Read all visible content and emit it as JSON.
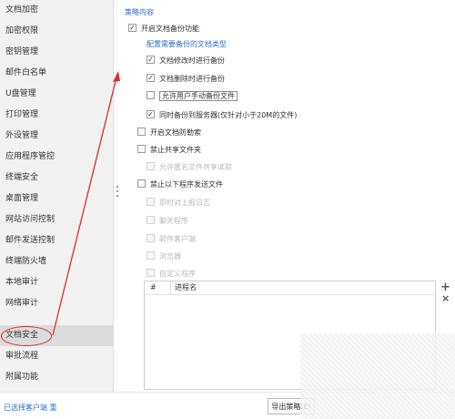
{
  "sidebar": {
    "items": [
      {
        "label": "文档加密"
      },
      {
        "label": "加密权限"
      },
      {
        "label": "密钥管理"
      },
      {
        "label": "邮件白名单"
      },
      {
        "label": "U盘管理"
      },
      {
        "label": "打印管理"
      },
      {
        "label": "外设管理"
      },
      {
        "label": "应用程序管控"
      },
      {
        "label": "终端安全"
      },
      {
        "label": "桌面管理"
      },
      {
        "label": "网站访问控制"
      },
      {
        "label": "邮件发送控制"
      },
      {
        "label": "终端防火墙"
      },
      {
        "label": "本地审计"
      },
      {
        "label": "网络审计"
      },
      {
        "label": "文档安全"
      },
      {
        "label": "审批流程"
      },
      {
        "label": "附属功能"
      }
    ],
    "active_index": 15,
    "bottom_link": "已选择客户端 重"
  },
  "main": {
    "section_title": "策略内容",
    "options": {
      "enable_backup": {
        "label": "开启文档备份功能",
        "checked": true
      },
      "group_title": "配置需要备份的文档类型",
      "modify_backup": {
        "label": "文档修改时进行备份",
        "checked": true
      },
      "delete_backup": {
        "label": "文档删除时进行备份",
        "checked": true
      },
      "manual_backup": {
        "label": "允许用户手动备份文件",
        "checked": false
      },
      "sync_server": {
        "label": "同时备份到服务器(仅针对小于20M的文件)",
        "checked": true
      },
      "anti_leak": {
        "label": "开启文档防勒索",
        "checked": false
      },
      "forbid_share": {
        "label": "禁止共享文件夹",
        "checked": false
      },
      "allow_readonly": {
        "label": "允许匿名文件共享读取",
        "checked": false
      },
      "forbid_programs": {
        "label": "禁止以下程序发送文件",
        "checked": false
      },
      "sub_items": [
        {
          "label": "即时对上报日志"
        },
        {
          "label": "聊天程序"
        },
        {
          "label": "邮件客户端"
        },
        {
          "label": "浏览器"
        },
        {
          "label": "自定义程序"
        }
      ]
    },
    "table": {
      "col_num": "#",
      "col_name": "进程名"
    },
    "add_symbol": "+",
    "del_symbol": "×",
    "export_button": "导出策略(E)"
  },
  "colors": {
    "accent": "#2f6fc4",
    "highlight_circle": "#e02828",
    "arrow": "#e02828"
  }
}
